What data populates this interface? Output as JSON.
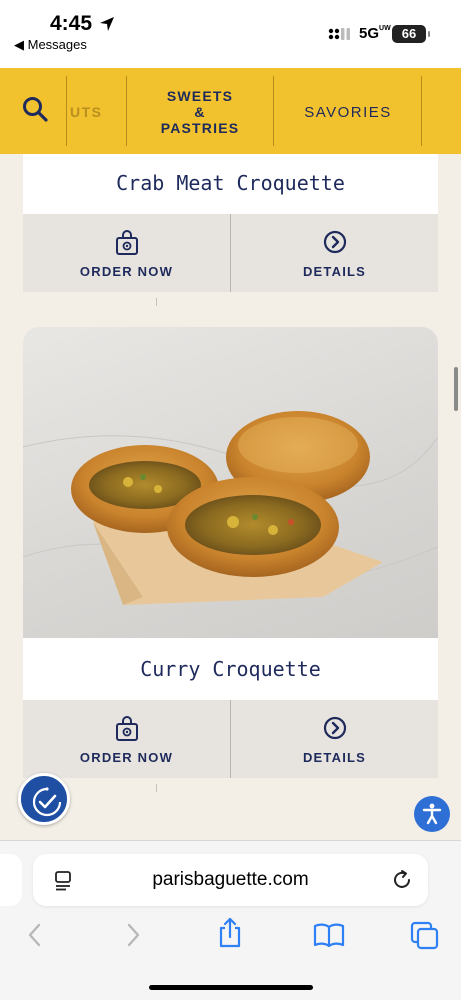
{
  "status_bar": {
    "time": "4:45",
    "back_label": "◀ Messages",
    "network": "5G",
    "network_superscript": "UW",
    "battery": "66"
  },
  "nav": {
    "cut_label": "UTS",
    "sweets_line1": "SWEETS",
    "sweets_line2": "&",
    "sweets_line3": "PASTRIES",
    "savories_label": "SAVORIES"
  },
  "products": [
    {
      "name": "Crab Meat Croquette",
      "order_label": "ORDER NOW",
      "details_label": "DETAILS"
    },
    {
      "name": "Curry Croquette",
      "order_label": "ORDER NOW",
      "details_label": "DETAILS"
    }
  ],
  "browser": {
    "url": "parisbaguette.com"
  },
  "colors": {
    "nav_yellow": "#f2c12e",
    "brand_navy": "#1e2a5c",
    "page_background": "#f4efe6",
    "action_background": "#e7e4df",
    "accessibility_blue": "#2e6fd6",
    "safari_blue": "#2f7ff5"
  },
  "icons": {
    "search": "magnifier-icon",
    "order": "shopping-bag-icon",
    "details": "chevron-right-circle-icon",
    "accessibility": "person-icon",
    "badge": "stopwatch-check-icon",
    "reader": "reader-mode-icon",
    "reload": "reload-icon",
    "back": "chevron-left-icon",
    "forward": "chevron-right-icon",
    "share": "share-icon",
    "bookmarks": "book-icon",
    "tabs": "tabs-icon"
  }
}
